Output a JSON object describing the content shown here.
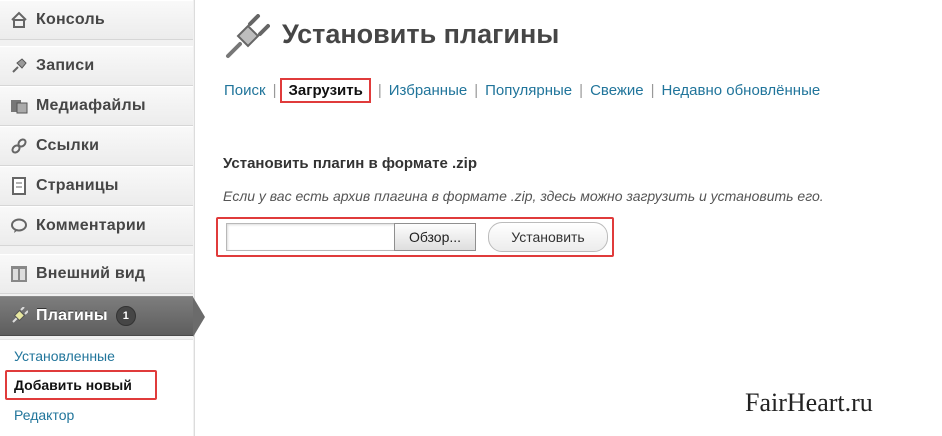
{
  "sidebar": {
    "items": [
      {
        "label": "Консоль",
        "icon": "home-icon"
      },
      {
        "label": "Записи",
        "icon": "pin-icon"
      },
      {
        "label": "Медиафайлы",
        "icon": "media-icon"
      },
      {
        "label": "Ссылки",
        "icon": "link-icon"
      },
      {
        "label": "Страницы",
        "icon": "pages-icon"
      },
      {
        "label": "Комментарии",
        "icon": "comments-icon"
      },
      {
        "label": "Внешний вид",
        "icon": "appearance-icon"
      },
      {
        "label": "Плагины",
        "icon": "plugin-icon",
        "badge": "1",
        "active": true
      }
    ],
    "submenu": [
      {
        "label": "Установленные"
      },
      {
        "label": "Добавить новый",
        "current": true
      },
      {
        "label": "Редактор"
      }
    ]
  },
  "main": {
    "title": "Установить плагины",
    "tabs": [
      {
        "label": "Поиск"
      },
      {
        "label": "Загрузить",
        "current": true
      },
      {
        "label": "Избранные"
      },
      {
        "label": "Популярные"
      },
      {
        "label": "Свежие"
      },
      {
        "label": "Недавно обновлённые"
      }
    ],
    "form_heading": "Установить плагин в формате .zip",
    "form_description": "Если у вас есть архив плагина в формате .zip, здесь можно загрузить и установить его.",
    "file_input_value": "",
    "browse_label": "Обзор...",
    "install_label": "Установить"
  },
  "watermark": "FairHeart.ru",
  "colors": {
    "link": "#21759b",
    "highlight": "#e03b3b",
    "active_menu": "#6b6b6b"
  }
}
